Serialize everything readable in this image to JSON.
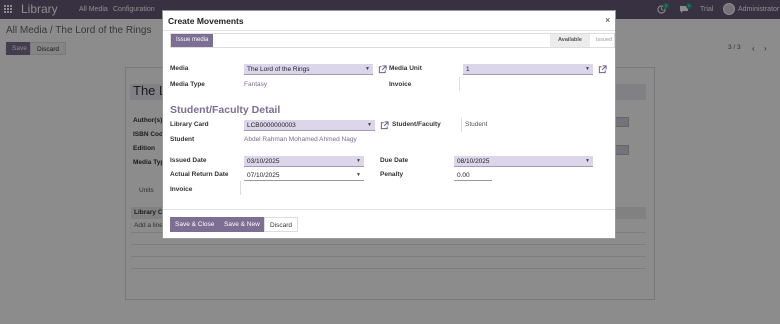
{
  "navbar": {
    "brand": "Library",
    "menus": [
      "All Media",
      "Configuration"
    ],
    "badges": [
      "2",
      "1"
    ],
    "trial": "Trial",
    "user": "Administrator"
  },
  "page": {
    "breadcrumb": "All Media / The Lord of the Rings",
    "save": "Save",
    "discard": "Discard",
    "pager": "3 / 3",
    "title_partial": "The L",
    "labels": [
      "Author(s)",
      "ISBN Code",
      "Edition",
      "Media Type"
    ],
    "units_tab": "Units",
    "list_header": "Library C",
    "add_line": "Add a line"
  },
  "modal": {
    "title": "Create Movements",
    "close": "×",
    "issue_button": "Issue media",
    "stages": {
      "active": "Available",
      "next": "Issued"
    },
    "fields": {
      "media_label": "Media",
      "media_value": "The Lord of the Rings",
      "media_unit_label": "Media Unit",
      "media_unit_value": "1",
      "media_type_label": "Media Type",
      "media_type_value": "Fantasy",
      "invoice_label": "Invoice",
      "section_title": "Student/Faculty Detail",
      "library_card_label": "Library Card",
      "library_card_value": "LCB0000000003",
      "student_faculty_label": "Student/Faculty",
      "student_faculty_value": "Student",
      "student_label": "Student",
      "student_value": "Abdel Rahman Mohamed Ahmed Nagy",
      "issued_date_label": "Issued Date",
      "issued_date_value": "03/10/2025",
      "due_date_label": "Due Date",
      "due_date_value": "08/10/2025",
      "actual_return_label": "Actual Return Date",
      "actual_return_value": "07/10/2025",
      "penalty_label": "Penalty",
      "penalty_value": "0.00",
      "invoice2_label": "Invoice"
    },
    "footer": {
      "save_close": "Save & Close",
      "save_new": "Save & New",
      "discard": "Discard"
    }
  },
  "colors": {
    "navbar": "#675a78",
    "primary": "#7c6f93",
    "select_bg": "#dcd6ea"
  }
}
